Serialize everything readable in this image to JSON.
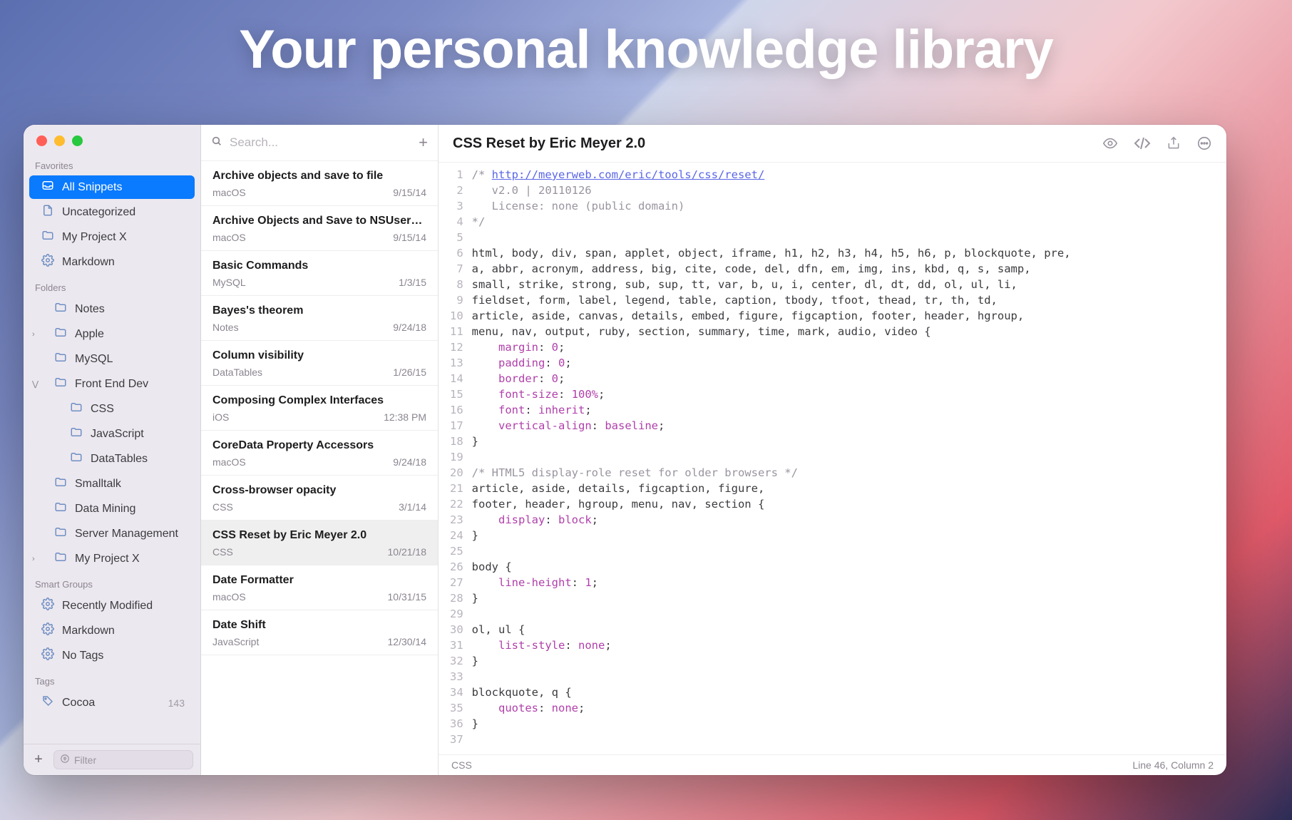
{
  "hero": "Your personal knowledge library",
  "sidebar": {
    "sections": {
      "favorites": {
        "title": "Favorites",
        "items": [
          {
            "icon": "tray",
            "label": "All Snippets",
            "active": true
          },
          {
            "icon": "doc",
            "label": "Uncategorized"
          },
          {
            "icon": "folder",
            "label": "My Project X"
          },
          {
            "icon": "gear",
            "label": "Markdown"
          }
        ]
      },
      "folders": {
        "title": "Folders",
        "items": [
          {
            "icon": "folder",
            "label": "Notes",
            "indent": 0
          },
          {
            "icon": "folder",
            "label": "Apple",
            "indent": 0,
            "disclosure": "closed"
          },
          {
            "icon": "folder",
            "label": "MySQL",
            "indent": 0
          },
          {
            "icon": "folder",
            "label": "Front End Dev",
            "indent": 0,
            "disclosure": "open"
          },
          {
            "icon": "folder",
            "label": "CSS",
            "indent": 1
          },
          {
            "icon": "folder",
            "label": "JavaScript",
            "indent": 1
          },
          {
            "icon": "folder",
            "label": "DataTables",
            "indent": 1
          },
          {
            "icon": "folder",
            "label": "Smalltalk",
            "indent": 0
          },
          {
            "icon": "folder",
            "label": "Data Mining",
            "indent": 0
          },
          {
            "icon": "folder",
            "label": "Server Management",
            "indent": 0
          },
          {
            "icon": "folder",
            "label": "My Project X",
            "indent": 0,
            "disclosure": "closed"
          }
        ]
      },
      "smart": {
        "title": "Smart Groups",
        "items": [
          {
            "icon": "gear",
            "label": "Recently Modified"
          },
          {
            "icon": "gear",
            "label": "Markdown"
          },
          {
            "icon": "gear",
            "label": "No Tags"
          }
        ]
      },
      "tags": {
        "title": "Tags",
        "items": [
          {
            "icon": "tag",
            "label": "Cocoa",
            "count": 143
          }
        ]
      }
    },
    "filter_placeholder": "Filter"
  },
  "list": {
    "search_placeholder": "Search...",
    "items": [
      {
        "title": "Archive objects and save to file",
        "category": "macOS",
        "date": "9/15/14"
      },
      {
        "title": "Archive Objects and Save to NSUser…",
        "category": "macOS",
        "date": "9/15/14"
      },
      {
        "title": "Basic Commands",
        "category": "MySQL",
        "date": "1/3/15"
      },
      {
        "title": "Bayes's theorem",
        "category": "Notes",
        "date": "9/24/18"
      },
      {
        "title": "Column visibility",
        "category": "DataTables",
        "date": "1/26/15"
      },
      {
        "title": "Composing Complex Interfaces",
        "category": "iOS",
        "date": "12:38 PM"
      },
      {
        "title": "CoreData Property Accessors",
        "category": "macOS",
        "date": "9/24/18"
      },
      {
        "title": "Cross-browser opacity",
        "category": "CSS",
        "date": "3/1/14"
      },
      {
        "title": "CSS Reset by Eric Meyer 2.0",
        "category": "CSS",
        "date": "10/21/18",
        "selected": true
      },
      {
        "title": "Date Formatter",
        "category": "macOS",
        "date": "10/31/15"
      },
      {
        "title": "Date Shift",
        "category": "JavaScript",
        "date": "12/30/14"
      }
    ]
  },
  "editor": {
    "title": "CSS Reset by Eric Meyer 2.0",
    "footer_left": "CSS",
    "footer_right": "Line 46, Column 2",
    "code_url": "http://meyerweb.com/eric/tools/css/reset/",
    "line_count": 37,
    "lines": [
      {
        "t": "/* ",
        "cls": "cm",
        "append_url": true
      },
      {
        "t": "   v2.0 | 20110126",
        "cls": "cm"
      },
      {
        "t": "   License: none (public domain)",
        "cls": "cm"
      },
      {
        "t": "*/",
        "cls": "cm"
      },
      {
        "t": ""
      },
      {
        "t": "html, body, div, span, applet, object, iframe, h1, h2, h3, h4, h5, h6, p, blockquote, pre,"
      },
      {
        "t": "a, abbr, acronym, address, big, cite, code, del, dfn, em, img, ins, kbd, q, s, samp,"
      },
      {
        "t": "small, strike, strong, sub, sup, tt, var, b, u, i, center, dl, dt, dd, ol, ul, li,"
      },
      {
        "t": "fieldset, form, label, legend, table, caption, tbody, tfoot, thead, tr, th, td,"
      },
      {
        "t": "article, aside, canvas, details, embed, figure, figcaption, footer, header, hgroup,"
      },
      {
        "t": "menu, nav, output, ruby, section, summary, time, mark, audio, video {"
      },
      {
        "t": "    margin: 0;",
        "props": [
          "margin"
        ],
        "nums": [
          "0"
        ]
      },
      {
        "t": "    padding: 0;",
        "props": [
          "padding"
        ],
        "nums": [
          "0"
        ]
      },
      {
        "t": "    border: 0;",
        "props": [
          "border"
        ],
        "nums": [
          "0"
        ]
      },
      {
        "t": "    font-size: 100%;",
        "props": [
          "font-size"
        ],
        "nums": [
          "100%"
        ]
      },
      {
        "t": "    font: inherit;",
        "props": [
          "font"
        ],
        "nums": [
          "inherit"
        ]
      },
      {
        "t": "    vertical-align: baseline;",
        "props": [
          "vertical-align"
        ],
        "nums": [
          "baseline"
        ]
      },
      {
        "t": "}"
      },
      {
        "t": ""
      },
      {
        "t": "/* HTML5 display-role reset for older browsers */",
        "cls": "cm"
      },
      {
        "t": "article, aside, details, figcaption, figure,"
      },
      {
        "t": "footer, header, hgroup, menu, nav, section {"
      },
      {
        "t": "    display: block;",
        "props": [
          "display"
        ],
        "nums": [
          "block"
        ]
      },
      {
        "t": "}"
      },
      {
        "t": ""
      },
      {
        "t": "body {"
      },
      {
        "t": "    line-height: 1;",
        "props": [
          "line-height"
        ],
        "nums": [
          "1"
        ]
      },
      {
        "t": "}"
      },
      {
        "t": ""
      },
      {
        "t": "ol, ul {"
      },
      {
        "t": "    list-style: none;",
        "props": [
          "list-style"
        ],
        "nums": [
          "none"
        ]
      },
      {
        "t": "}"
      },
      {
        "t": ""
      },
      {
        "t": "blockquote, q {"
      },
      {
        "t": "    quotes: none;",
        "props": [
          "quotes"
        ],
        "nums": [
          "none"
        ]
      },
      {
        "t": "}"
      },
      {
        "t": ""
      }
    ]
  }
}
